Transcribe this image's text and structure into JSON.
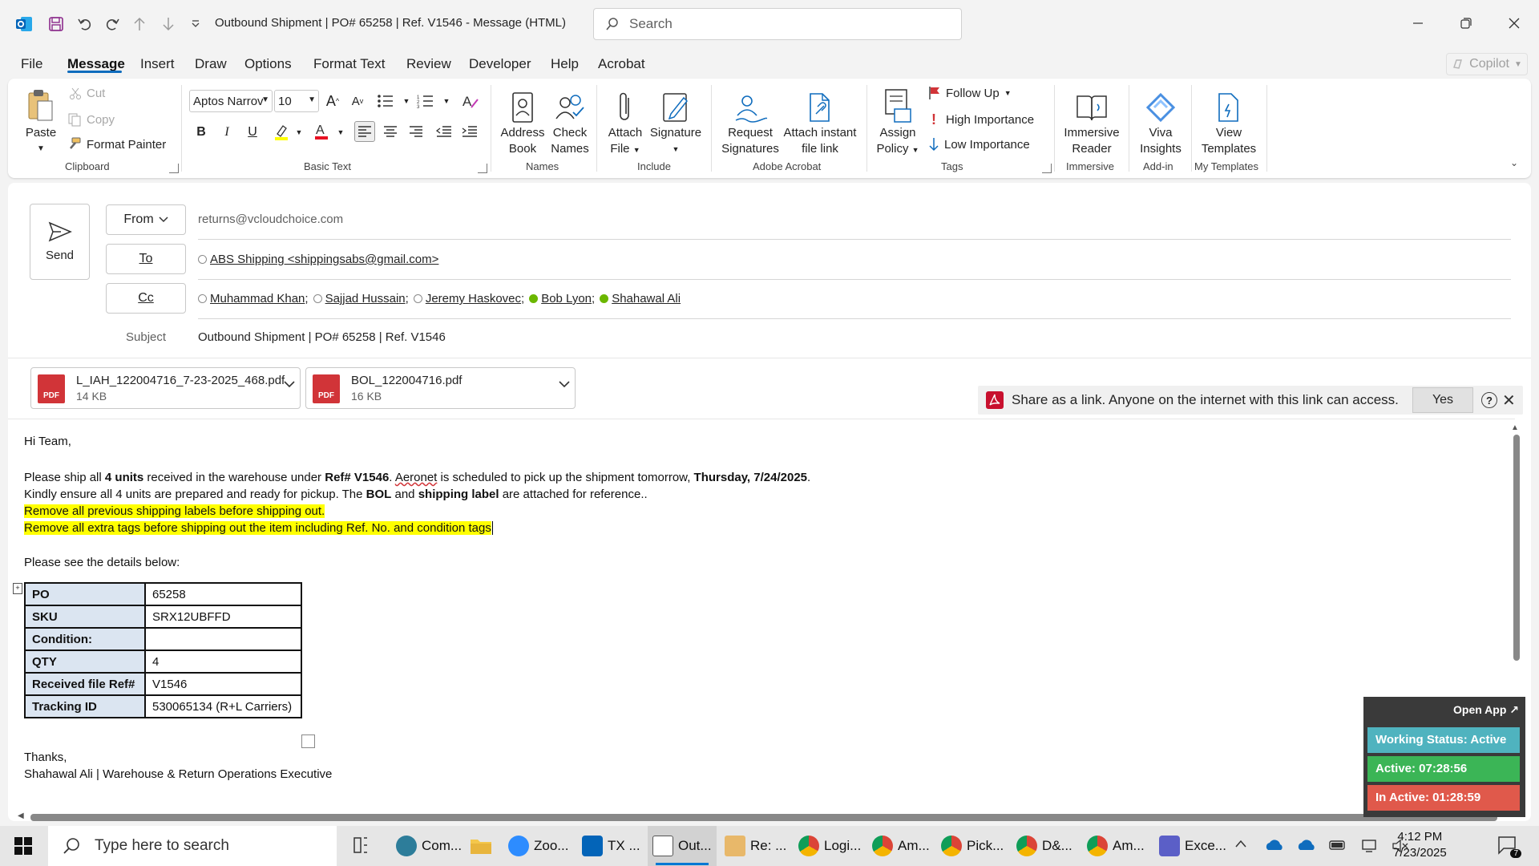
{
  "window": {
    "title": "Outbound Shipment | PO# 65258 | Ref. V1546  -  Message (HTML)",
    "search_placeholder": "Search"
  },
  "menu": {
    "tabs": [
      "File",
      "Message",
      "Insert",
      "Draw",
      "Options",
      "Format Text",
      "Review",
      "Developer",
      "Help",
      "Acrobat"
    ],
    "active": "Message",
    "copilot": "Copilot"
  },
  "ribbon": {
    "clipboard": {
      "paste": "Paste",
      "cut": "Cut",
      "copy": "Copy",
      "format_painter": "Format Painter",
      "label": "Clipboard"
    },
    "basic_text": {
      "font": "Aptos Narrov",
      "size": "10",
      "label": "Basic Text"
    },
    "names": {
      "address_book_1": "Address",
      "address_book_2": "Book",
      "check_names_1": "Check",
      "check_names_2": "Names",
      "label": "Names"
    },
    "include": {
      "attach_1": "Attach",
      "attach_2": "File",
      "signature": "Signature",
      "label": "Include"
    },
    "acrobat": {
      "request_1": "Request",
      "request_2": "Signatures",
      "attach_link_1": "Attach instant",
      "attach_link_2": "file link",
      "label": "Adobe Acrobat"
    },
    "tags": {
      "assign_1": "Assign",
      "assign_2": "Policy",
      "follow_up": "Follow Up",
      "high": "High Importance",
      "low": "Low Importance",
      "label": "Tags"
    },
    "immersive": {
      "reader_1": "Immersive",
      "reader_2": "Reader",
      "label": "Immersive"
    },
    "addin": {
      "viva_1": "Viva",
      "viva_2": "Insights",
      "label": "Add-in"
    },
    "templates": {
      "view_1": "View",
      "view_2": "Templates",
      "label": "My Templates"
    }
  },
  "header": {
    "send": "Send",
    "from_label": "From",
    "from_address": "returns@vcloudchoice.com",
    "to_label": "To",
    "to": [
      {
        "name": "ABS Shipping <shippingsabs@gmail.com>",
        "status": "unknown"
      }
    ],
    "cc_label": "Cc",
    "cc": [
      {
        "name": "Muhammad Khan",
        "status": "unknown"
      },
      {
        "name": "Sajjad Hussain",
        "status": "unknown"
      },
      {
        "name": "Jeremy Haskovec",
        "status": "unknown"
      },
      {
        "name": "Bob Lyon",
        "status": "available"
      },
      {
        "name": "Shahawal Ali",
        "status": "available"
      }
    ],
    "subject_label": "Subject",
    "subject": "Outbound Shipment | PO# 65258 | Ref. V1546"
  },
  "attachments": [
    {
      "name": "L_IAH_122004716_7-23-2025_468.pdf",
      "size": "14 KB",
      "type": "PDF"
    },
    {
      "name": "BOL_122004716.pdf",
      "size": "16 KB",
      "type": "PDF"
    }
  ],
  "share_bar": {
    "text": "Share as a link. Anyone on the internet with this link can access.",
    "yes": "Yes"
  },
  "body": {
    "greeting": "Hi Team,",
    "p1_a": "Please ship all ",
    "p1_b": "4 units",
    "p1_c": " received in the warehouse under ",
    "p1_d": "Ref# V1546",
    "p1_e": ". ",
    "p1_f": "Aeronet",
    "p1_g": " is scheduled to pick up the shipment tomorrow, ",
    "p1_h": "Thursday, 7/24/2025",
    "p1_i": ".",
    "p2_a": "Kindly ensure all 4 units are prepared and ready for pickup. The ",
    "p2_b": "BOL",
    "p2_c": " and ",
    "p2_d": "shipping label",
    "p2_e": " are attached for reference..",
    "hl1": "Remove all previous shipping labels before shipping out.",
    "hl2": "Remove all extra tags before shipping out the item including Ref. No. and condition tags",
    "details_intro": "Please see the details below:",
    "table": [
      {
        "k": "PO",
        "v": "65258"
      },
      {
        "k": "SKU",
        "v": "SRX12UBFFD"
      },
      {
        "k": "Condition:",
        "v": ""
      },
      {
        "k": "QTY",
        "v": "4"
      },
      {
        "k": "Received file Ref#",
        "v": "V1546"
      },
      {
        "k": "Tracking ID",
        "v": "530065134 (R+L Carriers)"
      }
    ],
    "thanks": "Thanks,",
    "signature": "Shahawal Ali | Warehouse & Return Operations Executive"
  },
  "widget": {
    "open_app": "Open App ↗",
    "working_status": "Working Status: Active",
    "active": "Active: 07:28:56",
    "inactive": "In Active: 01:28:59",
    "colors": {
      "status": "#4fb3bf",
      "active": "#3bb556",
      "inactive": "#e0594b"
    }
  },
  "taskbar": {
    "search_placeholder": "Type here to search",
    "apps": [
      "Com...",
      "Zoo...",
      "TX ...",
      "Out...",
      "Re: ...",
      "Logi...",
      "Am...",
      "Pick...",
      "D&...",
      "Am...",
      "Exce..."
    ],
    "time": "4:12 PM",
    "date": "7/23/2025",
    "notifications": "7"
  }
}
